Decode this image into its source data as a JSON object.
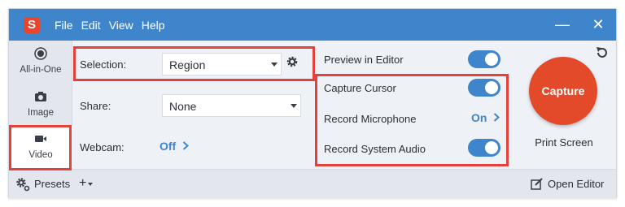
{
  "title_bar": {
    "logo_letter": "S",
    "menu": [
      "File",
      "Edit",
      "View",
      "Help"
    ],
    "minimize": "—",
    "close": "✕"
  },
  "modes": [
    {
      "label": "All-in-One",
      "icon": "radio-dot-icon"
    },
    {
      "label": "Image",
      "icon": "camera-icon"
    },
    {
      "label": "Video",
      "icon": "video-camera-icon"
    }
  ],
  "settings": {
    "selection": {
      "label": "Selection:",
      "value": "Region"
    },
    "share": {
      "label": "Share:",
      "value": "None"
    },
    "webcam": {
      "label": "Webcam:",
      "value": "Off"
    }
  },
  "options": {
    "preview_in_editor": {
      "label": "Preview in Editor",
      "on": true
    },
    "capture_cursor": {
      "label": "Capture Cursor",
      "on": true
    },
    "record_microphone": {
      "label": "Record Microphone",
      "value": "On"
    },
    "record_system_audio": {
      "label": "Record System Audio",
      "on": true
    }
  },
  "capture": {
    "button_label": "Capture",
    "hotkey": "Print Screen"
  },
  "bottom": {
    "presets_label": "Presets",
    "add_label": "+",
    "open_editor_label": "Open Editor"
  },
  "colors": {
    "accent": "#3f85cc",
    "capture": "#e34a2a",
    "highlight": "#e5403a"
  }
}
